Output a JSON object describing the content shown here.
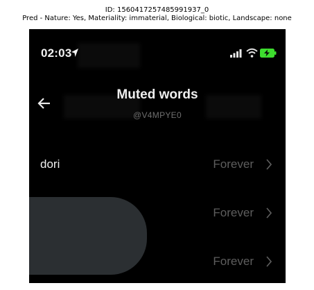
{
  "caption": {
    "line1": "ID: 1560417257485991937_0",
    "line2": "Pred - Nature: Yes, Materiality: immaterial, Biological: biotic, Landscape: none"
  },
  "status_bar": {
    "time": "02:03",
    "icons": [
      "location-arrow-icon",
      "signal-bars-icon",
      "wifi-icon",
      "battery-charging-icon"
    ]
  },
  "header": {
    "title": "Muted words",
    "handle": "@V4MPYE0",
    "back_icon": "back-arrow-icon"
  },
  "muted_words": [
    {
      "word": "dori",
      "duration": "Forever"
    },
    {
      "word": "",
      "duration": "Forever"
    },
    {
      "word": "",
      "duration": "Forever"
    }
  ],
  "colors": {
    "background": "#000000",
    "overlay": "#2b2f32",
    "battery": "#3ddc2e"
  }
}
